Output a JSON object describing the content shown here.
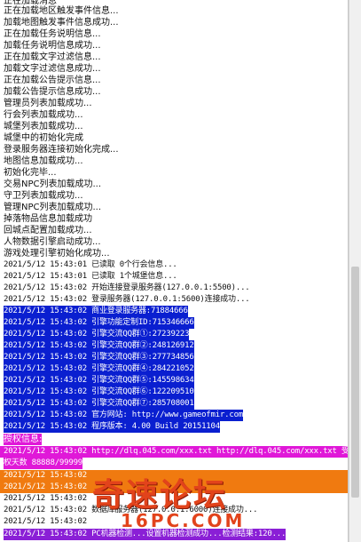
{
  "log": {
    "lines": [
      "正在加载消息",
      "正在加载地区触发事件信息...",
      "加载地图触发事件信息成功...",
      "正在加载任务说明信息...",
      "加载任务说明信息成功...",
      "正在加载文字过滤信息...",
      "加载文字过滤信息成功...",
      "正在加载公告提示信息...",
      "加载公告提示信息成功...",
      "管理员列表加载成功...",
      "行会列表加载成功...",
      "城堡列表加载成功...",
      "城堡中的初始化完成",
      "登录服务器连接初始化完成...",
      "地图信息加载成功...",
      "初始化完毕...",
      "交易NPC列表加载成功...",
      "守卫列表加载成功...",
      "管理NPC列表加载成功...",
      "掉落物品信息加载成功",
      "回城点配置加载成功...",
      "人物数据引擎启动成功...",
      "游戏处理引擎初始化成功...",
      "2021/5/12 15:43:01 已读取 0个行会信息...",
      "2021/5/12 15:43:01 已读取 1个城堡信息...",
      "2021/5/12 15:43:02 开始连接登录服务器(127.0.0.1:5500)...",
      "2021/5/12 15:43:02 登录服务器(127.0.0.1:5600)连接成功...",
      "2021/5/12 15:43:02 商业登录服务器:71884666",
      "2021/5/12 15:43:02 引擎功能定制ID:715346666",
      "2021/5/12 15:43:02 引擎交流QQ群①:27239223",
      "2021/5/12 15:43:02 引擎交流QQ群②:248126912",
      "2021/5/12 15:43:02 引擎交流QQ群③:277734856",
      "2021/5/12 15:43:02 引擎交流QQ群④:284221052",
      "2021/5/12 15:43:02 引擎交流QQ群⑤:145598634",
      "2021/5/12 15:43:02 引擎交流QQ群⑥:122209510",
      "2021/5/12 15:43:02 引擎交流QQ群⑦:285708001",
      "2021/5/12 15:43:02 官方网站: http://www.gameofmir.com",
      "2021/5/12 15:43:02 程序版本: 4.00 Build 20151104",
      "授权信息:",
      "2021/5/12 15:43:02 http://dlq.045.com/xxx.txt http://dlq.045.com/xxx.txt 受",
      "权天数 88888/99999",
      "2021/5/12 15:43:02",
      "2021/5/12 15:43:02",
      "2021/5/12 15:43:02",
      "2021/5/12 15:43:02 数据库服务器(127.0.0.1:6000)连接成功...",
      "2021/5/12 15:43:02",
      "2021/5/12 15:43:02 PC机器检测...设置机器检测成功...检测结果:120..."
    ]
  },
  "watermark": {
    "main": "奇速论坛",
    "sub": "16PC.COM"
  },
  "colors": {
    "highlight_blue": "#0a1fd0",
    "highlight_magenta": "#e018d8",
    "highlight_orange": "#f07a10",
    "highlight_purple": "#8a1fd6",
    "watermark": "#e2431b"
  }
}
